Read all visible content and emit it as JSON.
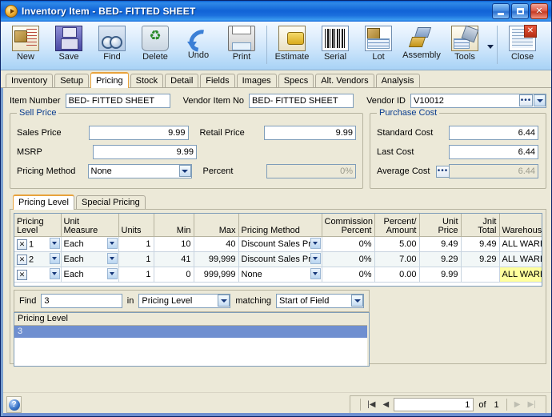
{
  "window": {
    "title": "Inventory Item - BED- FITTED SHEET",
    "icon": "play-circle-icon",
    "minimize_label": "",
    "maximize_label": "",
    "close_label": "✕"
  },
  "toolbar": {
    "buttons": [
      {
        "label": "New",
        "icon": "new-document-icon"
      },
      {
        "label": "Save",
        "icon": "floppy-disk-icon"
      },
      {
        "label": "Find",
        "icon": "binoculars-icon"
      },
      {
        "label": "Delete",
        "icon": "recycle-bin-icon"
      },
      {
        "label": "Undo",
        "icon": "undo-arrow-icon"
      },
      {
        "label": "Print",
        "icon": "printer-icon"
      },
      {
        "label": "Estimate",
        "icon": "estimate-calculator-icon"
      },
      {
        "label": "Serial",
        "icon": "barcode-icon"
      },
      {
        "label": "Lot",
        "icon": "lot-box-icon"
      },
      {
        "label": "Assembly",
        "icon": "assembly-blocks-icon"
      },
      {
        "label": "Tools",
        "icon": "tools-wrench-icon"
      },
      {
        "label": "Close",
        "icon": "close-window-icon"
      }
    ]
  },
  "tabs": [
    {
      "label": "Inventory",
      "active": false
    },
    {
      "label": "Setup",
      "active": false
    },
    {
      "label": "Pricing",
      "active": true
    },
    {
      "label": "Stock",
      "active": false
    },
    {
      "label": "Detail",
      "active": false
    },
    {
      "label": "Fields",
      "active": false
    },
    {
      "label": "Images",
      "active": false
    },
    {
      "label": "Specs",
      "active": false
    },
    {
      "label": "Alt. Vendors",
      "active": false
    },
    {
      "label": "Analysis",
      "active": false
    }
  ],
  "header_fields": {
    "item_number_label": "Item Number",
    "item_number_value": "BED- FITTED SHEET",
    "vendor_item_no_label": "Vendor Item No",
    "vendor_item_no_value": "BED- FITTED SHEET",
    "vendor_id_label": "Vendor ID",
    "vendor_id_value": "V10012"
  },
  "sell_price": {
    "title": "Sell Price",
    "sales_price_label": "Sales Price",
    "sales_price_value": "9.99",
    "retail_price_label": "Retail Price",
    "retail_price_value": "9.99",
    "msrp_label": "MSRP",
    "msrp_value": "9.99",
    "pricing_method_label": "Pricing Method",
    "pricing_method_value": "None",
    "percent_label": "Percent",
    "percent_value": "0%"
  },
  "purchase_cost": {
    "title": "Purchase Cost",
    "standard_cost_label": "Standard Cost",
    "standard_cost_value": "6.44",
    "last_cost_label": "Last Cost",
    "last_cost_value": "6.44",
    "average_cost_label": "Average Cost",
    "average_cost_value": "6.44"
  },
  "sub_tabs": [
    {
      "label": "Pricing Level",
      "active": true
    },
    {
      "label": "Special Pricing",
      "active": false
    }
  ],
  "grid": {
    "columns": [
      "Pricing Level",
      "Unit Measure",
      "Units",
      "Min",
      "Max",
      "Pricing Method",
      "Commission Percent",
      "Percent/ Amount",
      "Unit Price",
      "Jnit Total",
      "Warehouse"
    ],
    "rows": [
      {
        "delete": "✕",
        "pricing_level": "1",
        "unit_measure": "Each",
        "units": "1",
        "min": "10",
        "max": "40",
        "pricing_method": "Discount Sales Pric",
        "commission_percent": "0%",
        "percent_amount": "5.00",
        "unit_price": "9.49",
        "unit_total": "9.49",
        "warehouse": "ALL WARE"
      },
      {
        "delete": "✕",
        "pricing_level": "2",
        "unit_measure": "Each",
        "units": "1",
        "min": "41",
        "max": "99,999",
        "pricing_method": "Discount Sales Pric",
        "commission_percent": "0%",
        "percent_amount": "7.00",
        "unit_price": "9.29",
        "unit_total": "9.29",
        "warehouse": "ALL WARE"
      },
      {
        "delete": "✕",
        "pricing_level": "",
        "unit_measure": "Each",
        "units": "1",
        "min": "0",
        "max": "999,999",
        "pricing_method": "None",
        "commission_percent": "0%",
        "percent_amount": "0.00",
        "unit_price": "9.99",
        "unit_total": "",
        "warehouse": "ALL WARE"
      }
    ]
  },
  "find_bar": {
    "find_label": "Find",
    "find_value": "3",
    "in_label": "in",
    "field_value": "Pricing Level",
    "matching_label": "matching",
    "match_value": "Start of Field"
  },
  "drop_list": {
    "header": "Pricing Level",
    "items": [
      "3"
    ]
  },
  "status_bar": {
    "help_icon": "help-question-icon",
    "first_label": "|◀",
    "prev_label": "◀",
    "record_value": "1",
    "of_label": "of",
    "total_value": "1",
    "next_label": "▶",
    "last_label": "▶|"
  },
  "colors": {
    "title_blue": "#1163d6",
    "accent_orange": "#e8a33d",
    "group_label_blue": "#0a3d8f",
    "highlight_yellow": "#ffff9d",
    "selection_blue": "#6f8fd0"
  }
}
